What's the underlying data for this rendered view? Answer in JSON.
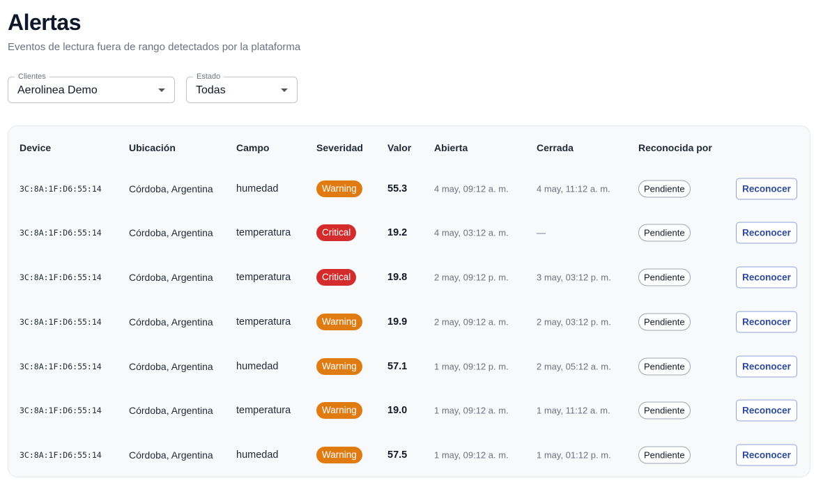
{
  "header": {
    "title": "Alertas",
    "subtitle": "Eventos de lectura fuera de rango detectados por la plataforma"
  },
  "filters": {
    "clientes": {
      "label": "Clientes",
      "value": "Aerolinea Demo"
    },
    "estado": {
      "label": "Estado",
      "value": "Todas"
    }
  },
  "table": {
    "columns": [
      "Device",
      "Ubicación",
      "Campo",
      "Severidad",
      "Valor",
      "Abierta",
      "Cerrada",
      "Reconocida por"
    ],
    "rows": [
      {
        "device": "3C:8A:1F:D6:55:14",
        "ubicacion": "Córdoba, Argentina",
        "campo": "humedad",
        "severidad": "Warning",
        "valor": "55.3",
        "abierta": "4 may, 09:12 a. m.",
        "cerrada": "4 may, 11:12 a. m.",
        "reconocida": "Pendiente",
        "action": "Reconocer"
      },
      {
        "device": "3C:8A:1F:D6:55:14",
        "ubicacion": "Córdoba, Argentina",
        "campo": "temperatura",
        "severidad": "Critical",
        "valor": "19.2",
        "abierta": "4 may, 03:12 a. m.",
        "cerrada": "—",
        "reconocida": "Pendiente",
        "action": "Reconocer"
      },
      {
        "device": "3C:8A:1F:D6:55:14",
        "ubicacion": "Córdoba, Argentina",
        "campo": "temperatura",
        "severidad": "Critical",
        "valor": "19.8",
        "abierta": "2 may, 09:12 p. m.",
        "cerrada": "3 may, 03:12 p. m.",
        "reconocida": "Pendiente",
        "action": "Reconocer"
      },
      {
        "device": "3C:8A:1F:D6:55:14",
        "ubicacion": "Córdoba, Argentina",
        "campo": "temperatura",
        "severidad": "Warning",
        "valor": "19.9",
        "abierta": "2 may, 09:12 a. m.",
        "cerrada": "2 may, 03:12 p. m.",
        "reconocida": "Pendiente",
        "action": "Reconocer"
      },
      {
        "device": "3C:8A:1F:D6:55:14",
        "ubicacion": "Córdoba, Argentina",
        "campo": "humedad",
        "severidad": "Warning",
        "valor": "57.1",
        "abierta": "1 may, 09:12 p. m.",
        "cerrada": "2 may, 05:12 a. m.",
        "reconocida": "Pendiente",
        "action": "Reconocer"
      },
      {
        "device": "3C:8A:1F:D6:55:14",
        "ubicacion": "Córdoba, Argentina",
        "campo": "temperatura",
        "severidad": "Warning",
        "valor": "19.0",
        "abierta": "1 may, 09:12 a. m.",
        "cerrada": "1 may, 11:12 a. m.",
        "reconocida": "Pendiente",
        "action": "Reconocer"
      },
      {
        "device": "3C:8A:1F:D6:55:14",
        "ubicacion": "Córdoba, Argentina",
        "campo": "humedad",
        "severidad": "Warning",
        "valor": "57.5",
        "abierta": "1 may, 09:12 a. m.",
        "cerrada": "1 may, 01:12 p. m.",
        "reconocida": "Pendiente",
        "action": "Reconocer"
      }
    ]
  },
  "colors": {
    "warning": "#e07b12",
    "critical": "#d42c2c",
    "action": "#2b4aa0"
  },
  "icons": {
    "dropdown": "caret-down-icon"
  }
}
